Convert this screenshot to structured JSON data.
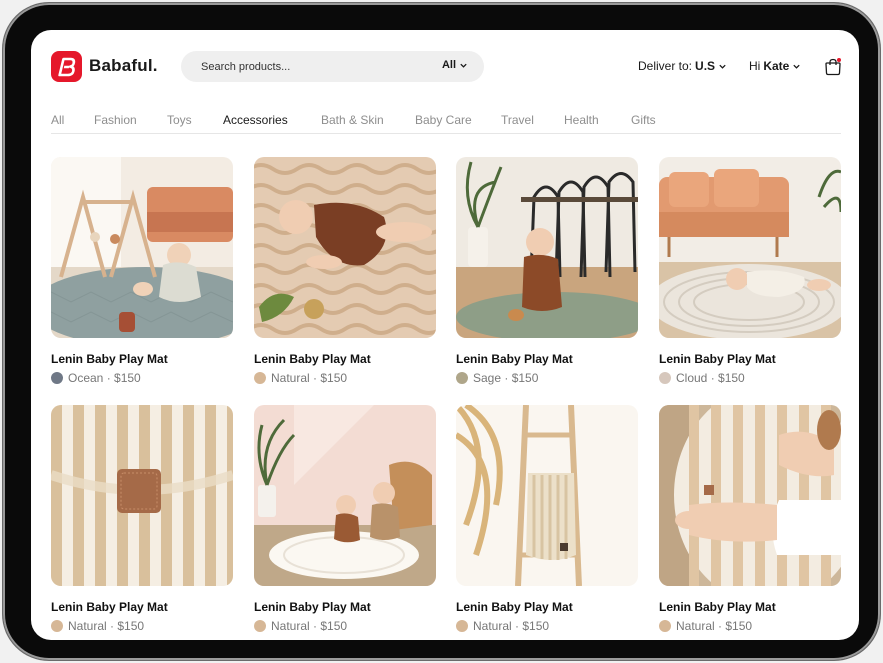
{
  "brand": {
    "name": "Babaful.",
    "accent": "#e5182b"
  },
  "search": {
    "placeholder": "Search products...",
    "filter": "All"
  },
  "header": {
    "deliver_label": "Deliver to:",
    "deliver_value": "U.S",
    "greet_prefix": "Hi",
    "greet_name": "Kate"
  },
  "tabs": [
    "All",
    "Fashion",
    "Toys",
    "Accessories",
    "Bath & Skin",
    "Baby Care",
    "Travel",
    "Health",
    "Gifts"
  ],
  "active_tab": "Accessories",
  "products": [
    {
      "name": "Lenin Baby Play Mat",
      "variant": "Ocean · $150",
      "swatch": "#6f7886"
    },
    {
      "name": "Lenin Baby Play Mat",
      "variant": "Natural · $150",
      "swatch": "#d6b796"
    },
    {
      "name": "Lenin Baby Play Mat",
      "variant": "Sage · $150",
      "swatch": "#afa68a"
    },
    {
      "name": "Lenin Baby Play Mat",
      "variant": "Cloud · $150",
      "swatch": "#d6c7bc"
    },
    {
      "name": "Lenin Baby Play Mat",
      "variant": "Natural · $150",
      "swatch": "#d6b796"
    },
    {
      "name": "Lenin Baby Play Mat",
      "variant": "Natural · $150",
      "swatch": "#d6b796"
    },
    {
      "name": "Lenin Baby Play Mat",
      "variant": "Natural · $150",
      "swatch": "#d6b796"
    },
    {
      "name": "Lenin Baby Play Mat",
      "variant": "Natural · $150",
      "swatch": "#d6b796"
    }
  ]
}
